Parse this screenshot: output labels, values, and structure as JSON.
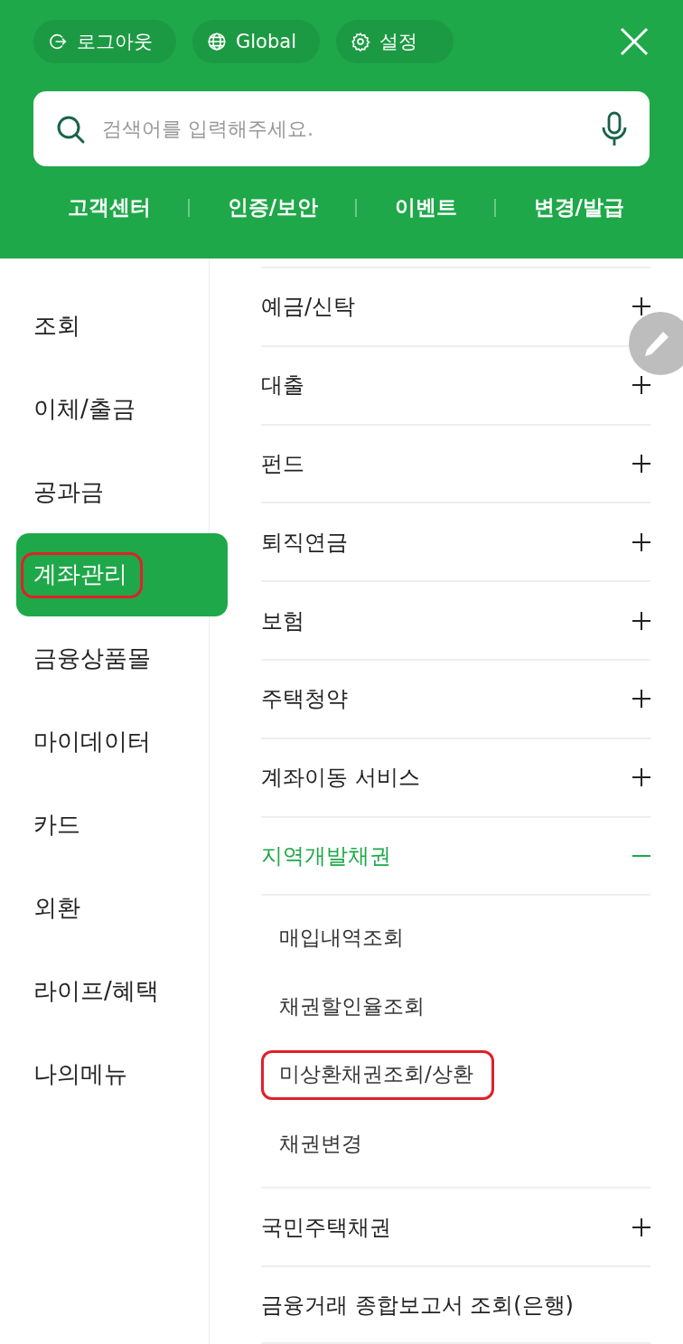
{
  "header": {
    "quick_buttons": [
      {
        "kind": "logout",
        "label": "로그아웃"
      },
      {
        "kind": "global",
        "label": "Global"
      },
      {
        "kind": "settings",
        "label": "설정"
      }
    ],
    "search": {
      "placeholder": "검색어를 입력해주세요."
    },
    "links": [
      "고객센터",
      "인증/보안",
      "이벤트",
      "변경/발급"
    ]
  },
  "sidebar": {
    "items": [
      {
        "label": "조회",
        "selected": false,
        "circled": false
      },
      {
        "label": "이체/출금",
        "selected": false,
        "circled": false
      },
      {
        "label": "공과금",
        "selected": false,
        "circled": false
      },
      {
        "label": "계좌관리",
        "selected": true,
        "circled": true
      },
      {
        "label": "금융상품몰",
        "selected": false,
        "circled": false
      },
      {
        "label": "마이데이터",
        "selected": false,
        "circled": false
      },
      {
        "label": "카드",
        "selected": false,
        "circled": false
      },
      {
        "label": "외환",
        "selected": false,
        "circled": false
      },
      {
        "label": "라이프/혜택",
        "selected": false,
        "circled": false
      },
      {
        "label": "나의메뉴",
        "selected": false,
        "circled": false
      }
    ]
  },
  "menu": {
    "items": [
      {
        "label": "예금/신탁",
        "expanded": false
      },
      {
        "label": "대출",
        "expanded": false
      },
      {
        "label": "펀드",
        "expanded": false
      },
      {
        "label": "퇴직연금",
        "expanded": false
      },
      {
        "label": "보험",
        "expanded": false
      },
      {
        "label": "주택청약",
        "expanded": false
      },
      {
        "label": "계좌이동 서비스",
        "expanded": false
      },
      {
        "label": "지역개발채권",
        "expanded": true,
        "children": [
          {
            "label": "매입내역조회",
            "circled": false
          },
          {
            "label": "채권할인율조회",
            "circled": false
          },
          {
            "label": "미상환채권조회/상환",
            "circled": true
          },
          {
            "label": "채권변경",
            "circled": false
          }
        ]
      },
      {
        "label": "국민주택채권",
        "expanded": false
      },
      {
        "label": "금융거래 종합보고서 조회(은행)",
        "kind": "link"
      }
    ]
  }
}
